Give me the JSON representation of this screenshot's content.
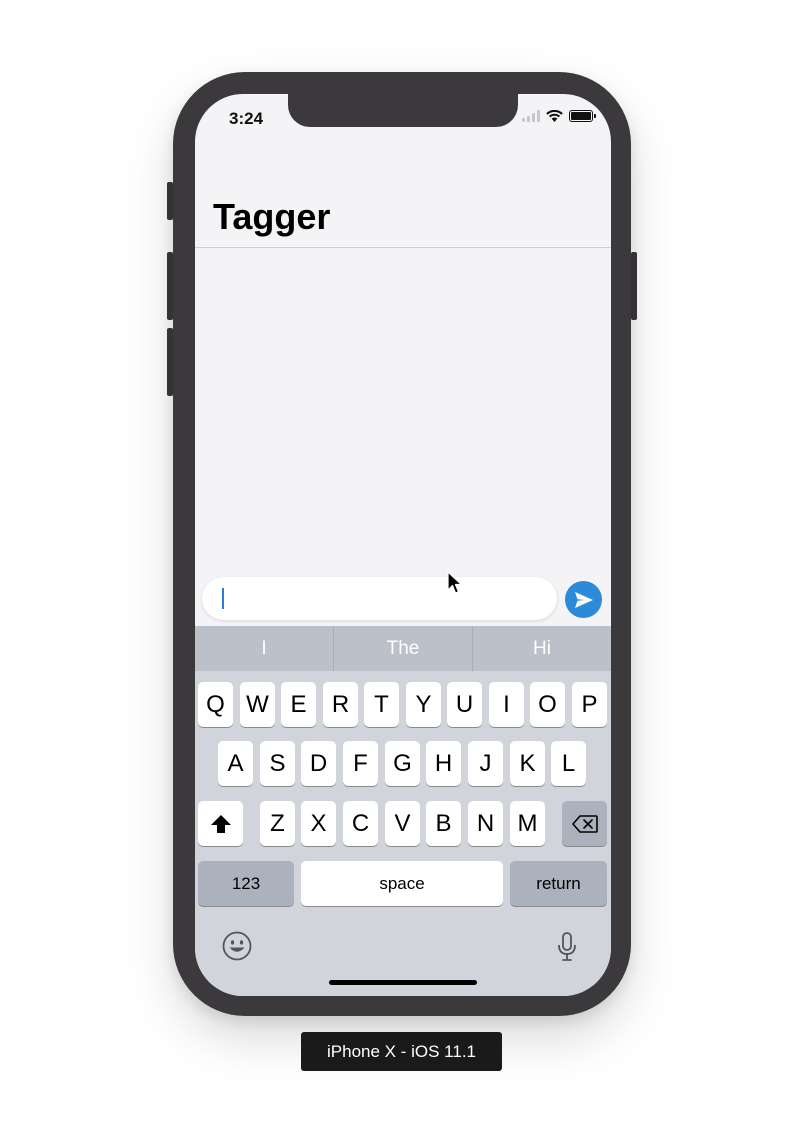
{
  "status_bar": {
    "time": "3:24"
  },
  "nav": {
    "title": "Tagger"
  },
  "composer": {
    "text": ""
  },
  "suggestions": [
    "I",
    "The",
    "Hi"
  ],
  "keyboard": {
    "row1": [
      "Q",
      "W",
      "E",
      "R",
      "T",
      "Y",
      "U",
      "I",
      "O",
      "P"
    ],
    "row2": [
      "A",
      "S",
      "D",
      "F",
      "G",
      "H",
      "J",
      "K",
      "L"
    ],
    "row3": [
      "Z",
      "X",
      "C",
      "V",
      "B",
      "N",
      "M"
    ],
    "numbers_label": "123",
    "space_label": "space",
    "return_label": "return"
  },
  "device_label": "iPhone X - iOS 11.1",
  "colors": {
    "send_button": "#2d8ad8",
    "caret": "#2d7bd3",
    "device_frame": "#3b393b"
  }
}
